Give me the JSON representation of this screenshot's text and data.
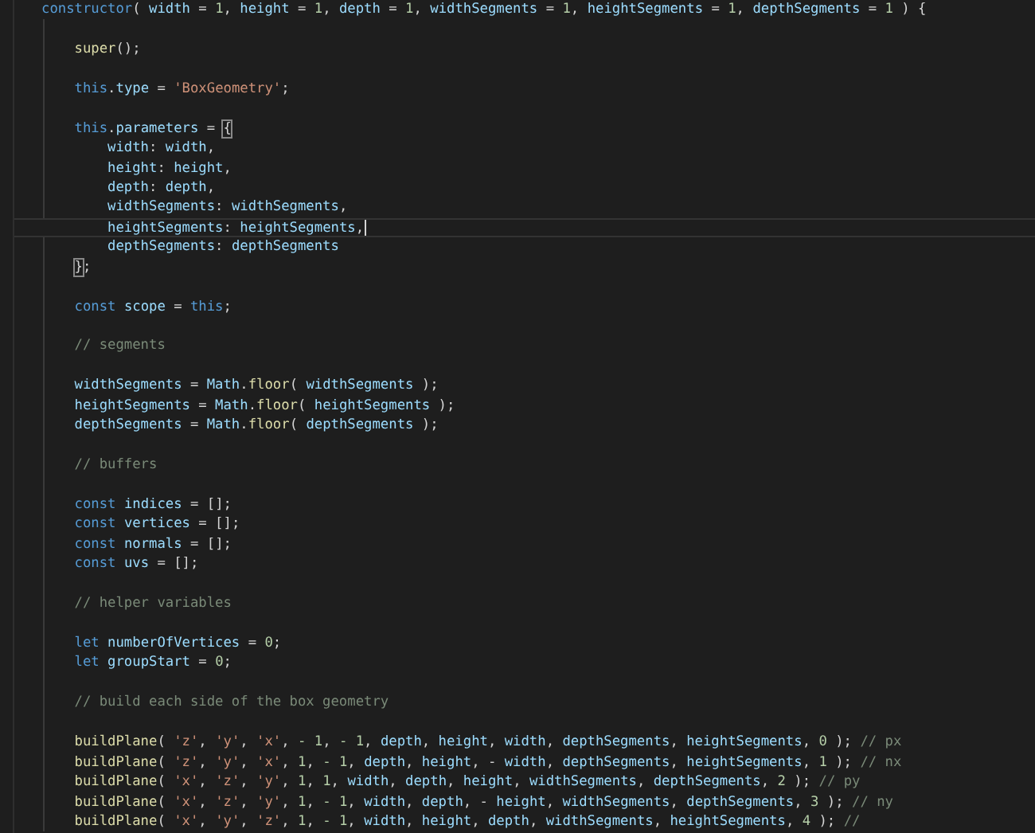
{
  "editor": {
    "lines": [
      {
        "kind": "code",
        "current": false,
        "tokens": [
          {
            "t": "constructor",
            "kind": "keyword"
          },
          {
            "t": "( ",
            "kind": "plain"
          },
          {
            "t": "width",
            "kind": "variable"
          },
          {
            "t": " = ",
            "kind": "plain"
          },
          {
            "t": "1",
            "kind": "number"
          },
          {
            "t": ", ",
            "kind": "plain"
          },
          {
            "t": "height",
            "kind": "variable"
          },
          {
            "t": " = ",
            "kind": "plain"
          },
          {
            "t": "1",
            "kind": "number"
          },
          {
            "t": ", ",
            "kind": "plain"
          },
          {
            "t": "depth",
            "kind": "variable"
          },
          {
            "t": " = ",
            "kind": "plain"
          },
          {
            "t": "1",
            "kind": "number"
          },
          {
            "t": ", ",
            "kind": "plain"
          },
          {
            "t": "widthSegments",
            "kind": "variable"
          },
          {
            "t": " = ",
            "kind": "plain"
          },
          {
            "t": "1",
            "kind": "number"
          },
          {
            "t": ", ",
            "kind": "plain"
          },
          {
            "t": "heightSegments",
            "kind": "variable"
          },
          {
            "t": " = ",
            "kind": "plain"
          },
          {
            "t": "1",
            "kind": "number"
          },
          {
            "t": ", ",
            "kind": "plain"
          },
          {
            "t": "depthSegments",
            "kind": "variable"
          },
          {
            "t": " = ",
            "kind": "plain"
          },
          {
            "t": "1",
            "kind": "number"
          },
          {
            "t": " ) {",
            "kind": "plain"
          }
        ]
      },
      {
        "kind": "blank",
        "current": false
      },
      {
        "kind": "code",
        "current": false,
        "tokens": [
          {
            "t": "    super",
            "kind": "function"
          },
          {
            "t": "();",
            "kind": "plain"
          }
        ]
      },
      {
        "kind": "blank",
        "current": false
      },
      {
        "kind": "code",
        "current": false,
        "tokens": [
          {
            "t": "    this",
            "kind": "keyword"
          },
          {
            "t": ".",
            "kind": "plain"
          },
          {
            "t": "type",
            "kind": "variable"
          },
          {
            "t": " = ",
            "kind": "plain"
          },
          {
            "t": "'BoxGeometry'",
            "kind": "string"
          },
          {
            "t": ";",
            "kind": "plain"
          }
        ]
      },
      {
        "kind": "blank",
        "current": false
      },
      {
        "kind": "code",
        "current": false,
        "tokens": [
          {
            "t": "    this",
            "kind": "keyword"
          },
          {
            "t": ".",
            "kind": "plain"
          },
          {
            "t": "parameters",
            "kind": "variable"
          },
          {
            "t": " = ",
            "kind": "plain"
          },
          {
            "t": "{",
            "kind": "bracket"
          }
        ]
      },
      {
        "kind": "code",
        "current": false,
        "tokens": [
          {
            "t": "        width",
            "kind": "variable"
          },
          {
            "t": ": ",
            "kind": "plain"
          },
          {
            "t": "width",
            "kind": "variable"
          },
          {
            "t": ",",
            "kind": "plain"
          }
        ]
      },
      {
        "kind": "code",
        "current": false,
        "tokens": [
          {
            "t": "        height",
            "kind": "variable"
          },
          {
            "t": ": ",
            "kind": "plain"
          },
          {
            "t": "height",
            "kind": "variable"
          },
          {
            "t": ",",
            "kind": "plain"
          }
        ]
      },
      {
        "kind": "code",
        "current": false,
        "tokens": [
          {
            "t": "        depth",
            "kind": "variable"
          },
          {
            "t": ": ",
            "kind": "plain"
          },
          {
            "t": "depth",
            "kind": "variable"
          },
          {
            "t": ",",
            "kind": "plain"
          }
        ]
      },
      {
        "kind": "code",
        "current": false,
        "tokens": [
          {
            "t": "        widthSegments",
            "kind": "variable"
          },
          {
            "t": ": ",
            "kind": "plain"
          },
          {
            "t": "widthSegments",
            "kind": "variable"
          },
          {
            "t": ",",
            "kind": "plain"
          }
        ]
      },
      {
        "kind": "code",
        "current": true,
        "tokens": [
          {
            "t": "        heightSegments",
            "kind": "variable"
          },
          {
            "t": ": ",
            "kind": "plain"
          },
          {
            "t": "heightSegments",
            "kind": "variable"
          },
          {
            "t": ",",
            "kind": "plain"
          }
        ]
      },
      {
        "kind": "code",
        "current": false,
        "tokens": [
          {
            "t": "        depthSegments",
            "kind": "variable"
          },
          {
            "t": ": ",
            "kind": "plain"
          },
          {
            "t": "depthSegments",
            "kind": "variable"
          }
        ]
      },
      {
        "kind": "code",
        "current": false,
        "tokens": [
          {
            "t": "    }",
            "kind": "bracket"
          },
          {
            "t": ";",
            "kind": "plain"
          }
        ]
      },
      {
        "kind": "blank",
        "current": false
      },
      {
        "kind": "code",
        "current": false,
        "tokens": [
          {
            "t": "    const ",
            "kind": "keyword"
          },
          {
            "t": "scope",
            "kind": "variable"
          },
          {
            "t": " = ",
            "kind": "plain"
          },
          {
            "t": "this",
            "kind": "keyword"
          },
          {
            "t": ";",
            "kind": "plain"
          }
        ]
      },
      {
        "kind": "blank",
        "current": false
      },
      {
        "kind": "code",
        "current": false,
        "tokens": [
          {
            "t": "    // segments",
            "kind": "comment"
          }
        ]
      },
      {
        "kind": "blank",
        "current": false
      },
      {
        "kind": "code",
        "current": false,
        "tokens": [
          {
            "t": "    widthSegments",
            "kind": "variable"
          },
          {
            "t": " = ",
            "kind": "plain"
          },
          {
            "t": "Math",
            "kind": "variable"
          },
          {
            "t": ".",
            "kind": "plain"
          },
          {
            "t": "floor",
            "kind": "function"
          },
          {
            "t": "( ",
            "kind": "plain"
          },
          {
            "t": "widthSegments",
            "kind": "variable"
          },
          {
            "t": " );",
            "kind": "plain"
          }
        ]
      },
      {
        "kind": "code",
        "current": false,
        "tokens": [
          {
            "t": "    heightSegments",
            "kind": "variable"
          },
          {
            "t": " = ",
            "kind": "plain"
          },
          {
            "t": "Math",
            "kind": "variable"
          },
          {
            "t": ".",
            "kind": "plain"
          },
          {
            "t": "floor",
            "kind": "function"
          },
          {
            "t": "( ",
            "kind": "plain"
          },
          {
            "t": "heightSegments",
            "kind": "variable"
          },
          {
            "t": " );",
            "kind": "plain"
          }
        ]
      },
      {
        "kind": "code",
        "current": false,
        "tokens": [
          {
            "t": "    depthSegments",
            "kind": "variable"
          },
          {
            "t": " = ",
            "kind": "plain"
          },
          {
            "t": "Math",
            "kind": "variable"
          },
          {
            "t": ".",
            "kind": "plain"
          },
          {
            "t": "floor",
            "kind": "function"
          },
          {
            "t": "( ",
            "kind": "plain"
          },
          {
            "t": "depthSegments",
            "kind": "variable"
          },
          {
            "t": " );",
            "kind": "plain"
          }
        ]
      },
      {
        "kind": "blank",
        "current": false
      },
      {
        "kind": "code",
        "current": false,
        "tokens": [
          {
            "t": "    // buffers",
            "kind": "comment"
          }
        ]
      },
      {
        "kind": "blank",
        "current": false
      },
      {
        "kind": "code",
        "current": false,
        "tokens": [
          {
            "t": "    const ",
            "kind": "keyword"
          },
          {
            "t": "indices",
            "kind": "variable"
          },
          {
            "t": " = [];",
            "kind": "plain"
          }
        ]
      },
      {
        "kind": "code",
        "current": false,
        "tokens": [
          {
            "t": "    const ",
            "kind": "keyword"
          },
          {
            "t": "vertices",
            "kind": "variable"
          },
          {
            "t": " = [];",
            "kind": "plain"
          }
        ]
      },
      {
        "kind": "code",
        "current": false,
        "tokens": [
          {
            "t": "    const ",
            "kind": "keyword"
          },
          {
            "t": "normals",
            "kind": "variable"
          },
          {
            "t": " = [];",
            "kind": "plain"
          }
        ]
      },
      {
        "kind": "code",
        "current": false,
        "tokens": [
          {
            "t": "    const ",
            "kind": "keyword"
          },
          {
            "t": "uvs",
            "kind": "variable"
          },
          {
            "t": " = [];",
            "kind": "plain"
          }
        ]
      },
      {
        "kind": "blank",
        "current": false
      },
      {
        "kind": "code",
        "current": false,
        "tokens": [
          {
            "t": "    // helper variables",
            "kind": "comment"
          }
        ]
      },
      {
        "kind": "blank",
        "current": false
      },
      {
        "kind": "code",
        "current": false,
        "tokens": [
          {
            "t": "    let ",
            "kind": "keyword"
          },
          {
            "t": "numberOfVertices",
            "kind": "variable"
          },
          {
            "t": " = ",
            "kind": "plain"
          },
          {
            "t": "0",
            "kind": "number"
          },
          {
            "t": ";",
            "kind": "plain"
          }
        ]
      },
      {
        "kind": "code",
        "current": false,
        "tokens": [
          {
            "t": "    let ",
            "kind": "keyword"
          },
          {
            "t": "groupStart",
            "kind": "variable"
          },
          {
            "t": " = ",
            "kind": "plain"
          },
          {
            "t": "0",
            "kind": "number"
          },
          {
            "t": ";",
            "kind": "plain"
          }
        ]
      },
      {
        "kind": "blank",
        "current": false
      },
      {
        "kind": "code",
        "current": false,
        "tokens": [
          {
            "t": "    // build each side of the box geometry",
            "kind": "comment"
          }
        ]
      },
      {
        "kind": "blank",
        "current": false
      },
      {
        "kind": "code",
        "current": false,
        "tokens": [
          {
            "t": "    buildPlane",
            "kind": "function"
          },
          {
            "t": "( ",
            "kind": "plain"
          },
          {
            "t": "'z'",
            "kind": "string"
          },
          {
            "t": ", ",
            "kind": "plain"
          },
          {
            "t": "'y'",
            "kind": "string"
          },
          {
            "t": ", ",
            "kind": "plain"
          },
          {
            "t": "'x'",
            "kind": "string"
          },
          {
            "t": ", ",
            "kind": "plain"
          },
          {
            "t": "- 1",
            "kind": "number"
          },
          {
            "t": ", ",
            "kind": "plain"
          },
          {
            "t": "- 1",
            "kind": "number"
          },
          {
            "t": ", ",
            "kind": "plain"
          },
          {
            "t": "depth",
            "kind": "variable"
          },
          {
            "t": ", ",
            "kind": "plain"
          },
          {
            "t": "height",
            "kind": "variable"
          },
          {
            "t": ", ",
            "kind": "plain"
          },
          {
            "t": "width",
            "kind": "variable"
          },
          {
            "t": ", ",
            "kind": "plain"
          },
          {
            "t": "depthSegments",
            "kind": "variable"
          },
          {
            "t": ", ",
            "kind": "plain"
          },
          {
            "t": "heightSegments",
            "kind": "variable"
          },
          {
            "t": ", ",
            "kind": "plain"
          },
          {
            "t": "0",
            "kind": "number"
          },
          {
            "t": " ); ",
            "kind": "plain"
          },
          {
            "t": "// px",
            "kind": "comment"
          }
        ]
      },
      {
        "kind": "code",
        "current": false,
        "tokens": [
          {
            "t": "    buildPlane",
            "kind": "function"
          },
          {
            "t": "( ",
            "kind": "plain"
          },
          {
            "t": "'z'",
            "kind": "string"
          },
          {
            "t": ", ",
            "kind": "plain"
          },
          {
            "t": "'y'",
            "kind": "string"
          },
          {
            "t": ", ",
            "kind": "plain"
          },
          {
            "t": "'x'",
            "kind": "string"
          },
          {
            "t": ", ",
            "kind": "plain"
          },
          {
            "t": "1",
            "kind": "number"
          },
          {
            "t": ", ",
            "kind": "plain"
          },
          {
            "t": "- 1",
            "kind": "number"
          },
          {
            "t": ", ",
            "kind": "plain"
          },
          {
            "t": "depth",
            "kind": "variable"
          },
          {
            "t": ", ",
            "kind": "plain"
          },
          {
            "t": "height",
            "kind": "variable"
          },
          {
            "t": ", - ",
            "kind": "plain"
          },
          {
            "t": "width",
            "kind": "variable"
          },
          {
            "t": ", ",
            "kind": "plain"
          },
          {
            "t": "depthSegments",
            "kind": "variable"
          },
          {
            "t": ", ",
            "kind": "plain"
          },
          {
            "t": "heightSegments",
            "kind": "variable"
          },
          {
            "t": ", ",
            "kind": "plain"
          },
          {
            "t": "1",
            "kind": "number"
          },
          {
            "t": " ); ",
            "kind": "plain"
          },
          {
            "t": "// nx",
            "kind": "comment"
          }
        ]
      },
      {
        "kind": "code",
        "current": false,
        "tokens": [
          {
            "t": "    buildPlane",
            "kind": "function"
          },
          {
            "t": "( ",
            "kind": "plain"
          },
          {
            "t": "'x'",
            "kind": "string"
          },
          {
            "t": ", ",
            "kind": "plain"
          },
          {
            "t": "'z'",
            "kind": "string"
          },
          {
            "t": ", ",
            "kind": "plain"
          },
          {
            "t": "'y'",
            "kind": "string"
          },
          {
            "t": ", ",
            "kind": "plain"
          },
          {
            "t": "1",
            "kind": "number"
          },
          {
            "t": ", ",
            "kind": "plain"
          },
          {
            "t": "1",
            "kind": "number"
          },
          {
            "t": ", ",
            "kind": "plain"
          },
          {
            "t": "width",
            "kind": "variable"
          },
          {
            "t": ", ",
            "kind": "plain"
          },
          {
            "t": "depth",
            "kind": "variable"
          },
          {
            "t": ", ",
            "kind": "plain"
          },
          {
            "t": "height",
            "kind": "variable"
          },
          {
            "t": ", ",
            "kind": "plain"
          },
          {
            "t": "widthSegments",
            "kind": "variable"
          },
          {
            "t": ", ",
            "kind": "plain"
          },
          {
            "t": "depthSegments",
            "kind": "variable"
          },
          {
            "t": ", ",
            "kind": "plain"
          },
          {
            "t": "2",
            "kind": "number"
          },
          {
            "t": " ); ",
            "kind": "plain"
          },
          {
            "t": "// py",
            "kind": "comment"
          }
        ]
      },
      {
        "kind": "code",
        "current": false,
        "tokens": [
          {
            "t": "    buildPlane",
            "kind": "function"
          },
          {
            "t": "( ",
            "kind": "plain"
          },
          {
            "t": "'x'",
            "kind": "string"
          },
          {
            "t": ", ",
            "kind": "plain"
          },
          {
            "t": "'z'",
            "kind": "string"
          },
          {
            "t": ", ",
            "kind": "plain"
          },
          {
            "t": "'y'",
            "kind": "string"
          },
          {
            "t": ", ",
            "kind": "plain"
          },
          {
            "t": "1",
            "kind": "number"
          },
          {
            "t": ", ",
            "kind": "plain"
          },
          {
            "t": "- 1",
            "kind": "number"
          },
          {
            "t": ", ",
            "kind": "plain"
          },
          {
            "t": "width",
            "kind": "variable"
          },
          {
            "t": ", ",
            "kind": "plain"
          },
          {
            "t": "depth",
            "kind": "variable"
          },
          {
            "t": ", - ",
            "kind": "plain"
          },
          {
            "t": "height",
            "kind": "variable"
          },
          {
            "t": ", ",
            "kind": "plain"
          },
          {
            "t": "widthSegments",
            "kind": "variable"
          },
          {
            "t": ", ",
            "kind": "plain"
          },
          {
            "t": "depthSegments",
            "kind": "variable"
          },
          {
            "t": ", ",
            "kind": "plain"
          },
          {
            "t": "3",
            "kind": "number"
          },
          {
            "t": " ); ",
            "kind": "plain"
          },
          {
            "t": "// ny",
            "kind": "comment"
          }
        ]
      },
      {
        "kind": "code",
        "current": false,
        "tokens": [
          {
            "t": "    buildPlane",
            "kind": "function"
          },
          {
            "t": "( ",
            "kind": "plain"
          },
          {
            "t": "'x'",
            "kind": "string"
          },
          {
            "t": ", ",
            "kind": "plain"
          },
          {
            "t": "'y'",
            "kind": "string"
          },
          {
            "t": ", ",
            "kind": "plain"
          },
          {
            "t": "'z'",
            "kind": "string"
          },
          {
            "t": ", ",
            "kind": "plain"
          },
          {
            "t": "1",
            "kind": "number"
          },
          {
            "t": ", ",
            "kind": "plain"
          },
          {
            "t": "- 1",
            "kind": "number"
          },
          {
            "t": ", ",
            "kind": "plain"
          },
          {
            "t": "width",
            "kind": "variable"
          },
          {
            "t": ", ",
            "kind": "plain"
          },
          {
            "t": "height",
            "kind": "variable"
          },
          {
            "t": ", ",
            "kind": "plain"
          },
          {
            "t": "depth",
            "kind": "variable"
          },
          {
            "t": ", ",
            "kind": "plain"
          },
          {
            "t": "widthSegments",
            "kind": "variable"
          },
          {
            "t": ", ",
            "kind": "plain"
          },
          {
            "t": "heightSegments",
            "kind": "variable"
          },
          {
            "t": ", ",
            "kind": "plain"
          },
          {
            "t": "4",
            "kind": "number"
          },
          {
            "t": " ); ",
            "kind": "plain"
          },
          {
            "t": "//",
            "kind": "comment"
          }
        ]
      }
    ]
  }
}
